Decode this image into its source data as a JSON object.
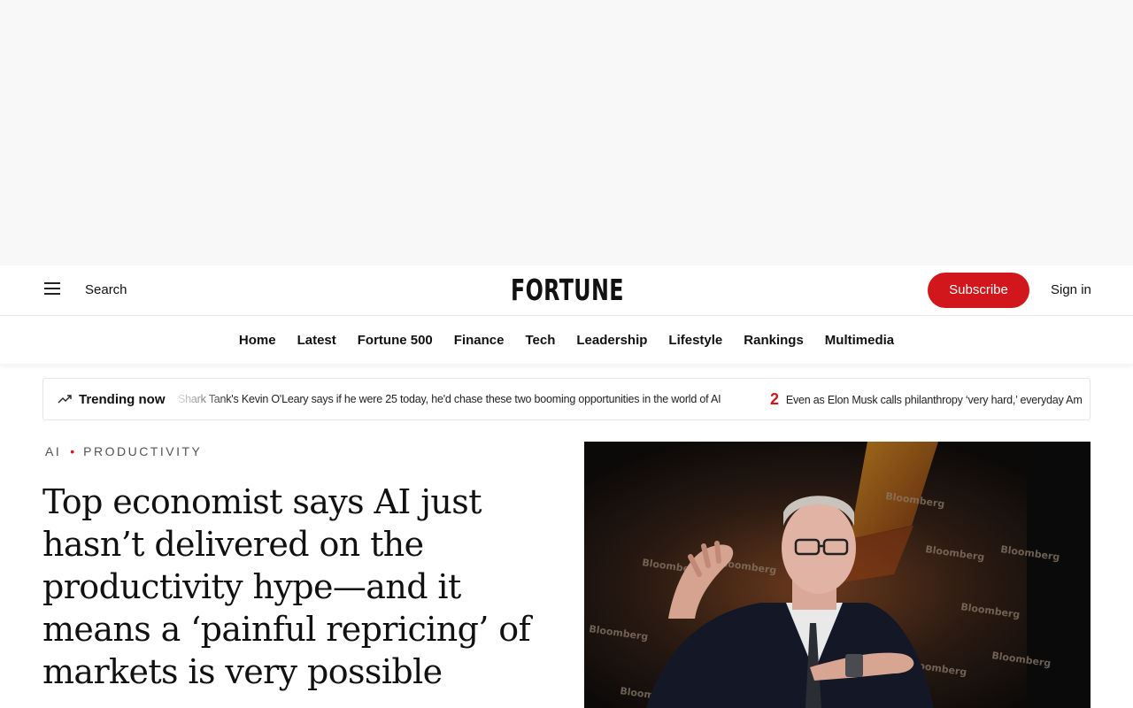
{
  "masthead": {
    "search_label": "Search",
    "logo_text": "FORTUNE",
    "subscribe_label": "Subscribe",
    "signin_label": "Sign in"
  },
  "nav": {
    "items": [
      "Home",
      "Latest",
      "Fortune 500",
      "Finance",
      "Tech",
      "Leadership",
      "Lifestyle",
      "Rankings",
      "Multimedia"
    ]
  },
  "trending": {
    "label": "Trending now",
    "items": [
      {
        "number": "",
        "text": "Shark Tank's Kevin O'Leary says if he were 25 today, he'd chase these two booming opportunities in the world of AI"
      },
      {
        "number": "2",
        "text": "Even as Elon Musk calls philanthropy ‘very hard,’ everyday Am"
      }
    ]
  },
  "article": {
    "tags": [
      "AI",
      "PRODUCTIVITY"
    ],
    "headline": "Top economist says AI just hasn’t delivered on the productivity hype—and it means a ‘painful repricing’ of markets is very possible"
  },
  "hero_image": {
    "backdrop_word": "Bloomberg"
  },
  "colors": {
    "brand_red": "#d1161c",
    "ad_background": "#f8f8f8"
  }
}
